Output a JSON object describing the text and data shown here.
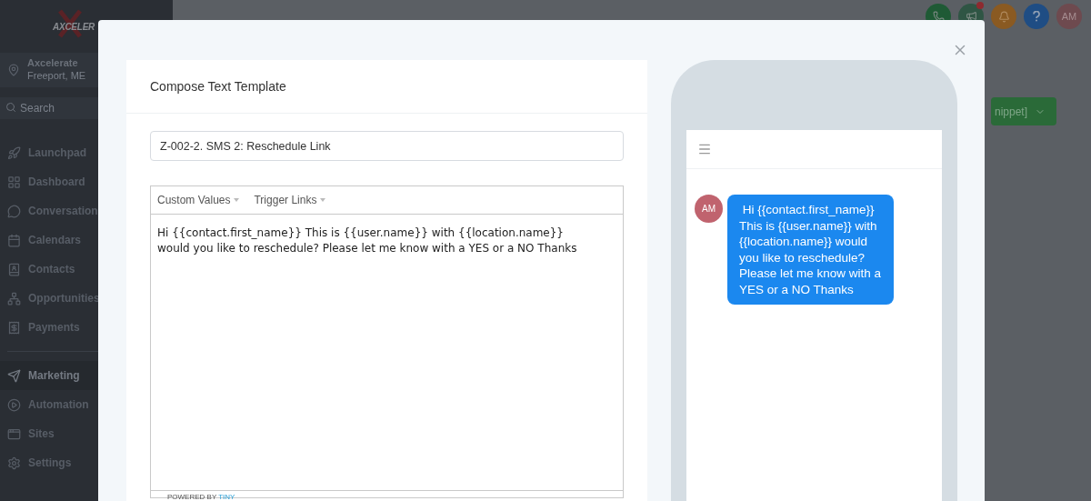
{
  "sidebar": {
    "logo": "AXCELER",
    "location": {
      "name": "Axcelerate",
      "place": "Freeport, ME"
    },
    "search": {
      "placeholder": "Search"
    },
    "items": [
      {
        "kind": "launchpad",
        "label": "Launchpad",
        "selected": false
      },
      {
        "kind": "dashboard",
        "label": "Dashboard",
        "selected": false
      },
      {
        "kind": "conversations",
        "label": "Conversation",
        "selected": false
      },
      {
        "kind": "calendars",
        "label": "Calendars",
        "selected": false
      },
      {
        "kind": "contacts",
        "label": "Contacts",
        "selected": false
      },
      {
        "kind": "opportunities",
        "label": "Opportunities",
        "selected": false
      },
      {
        "kind": "payments",
        "label": "Payments",
        "selected": false
      },
      {
        "kind": "divider"
      },
      {
        "kind": "marketing",
        "label": "Marketing",
        "selected": true
      },
      {
        "kind": "automation",
        "label": "Automation",
        "selected": false
      },
      {
        "kind": "sites",
        "label": "Sites",
        "selected": false
      },
      {
        "kind": "settings",
        "label": "Settings",
        "selected": false
      }
    ]
  },
  "header": {
    "buttons": [
      {
        "kind": "phone"
      },
      {
        "kind": "megaphone",
        "badge": true
      },
      {
        "kind": "bell"
      },
      {
        "kind": "help"
      },
      {
        "kind": "avatar",
        "label": "AM"
      }
    ],
    "snippet_button": "nippet]"
  },
  "modal": {
    "card": {
      "title": "Compose Text Template",
      "name_value": "Z-002-2. SMS 2: Reschedule Link",
      "toolbar": [
        "Custom Values",
        "Trigger Links"
      ],
      "body": "Hi {{contact.first_name}} This is {{user.name}} with {{location.name}} would you like to reschedule? Please let me know with a YES or a NO Thanks",
      "footer": {
        "text": "POWERED BY",
        "link": "TINY"
      }
    },
    "preview": {
      "avatar": "AM",
      "message": " Hi {{contact.first_name}} This is {{user.name}} with {{location.name}} would you like to reschedule? Please let me know with a YES or a NO Thanks"
    }
  }
}
